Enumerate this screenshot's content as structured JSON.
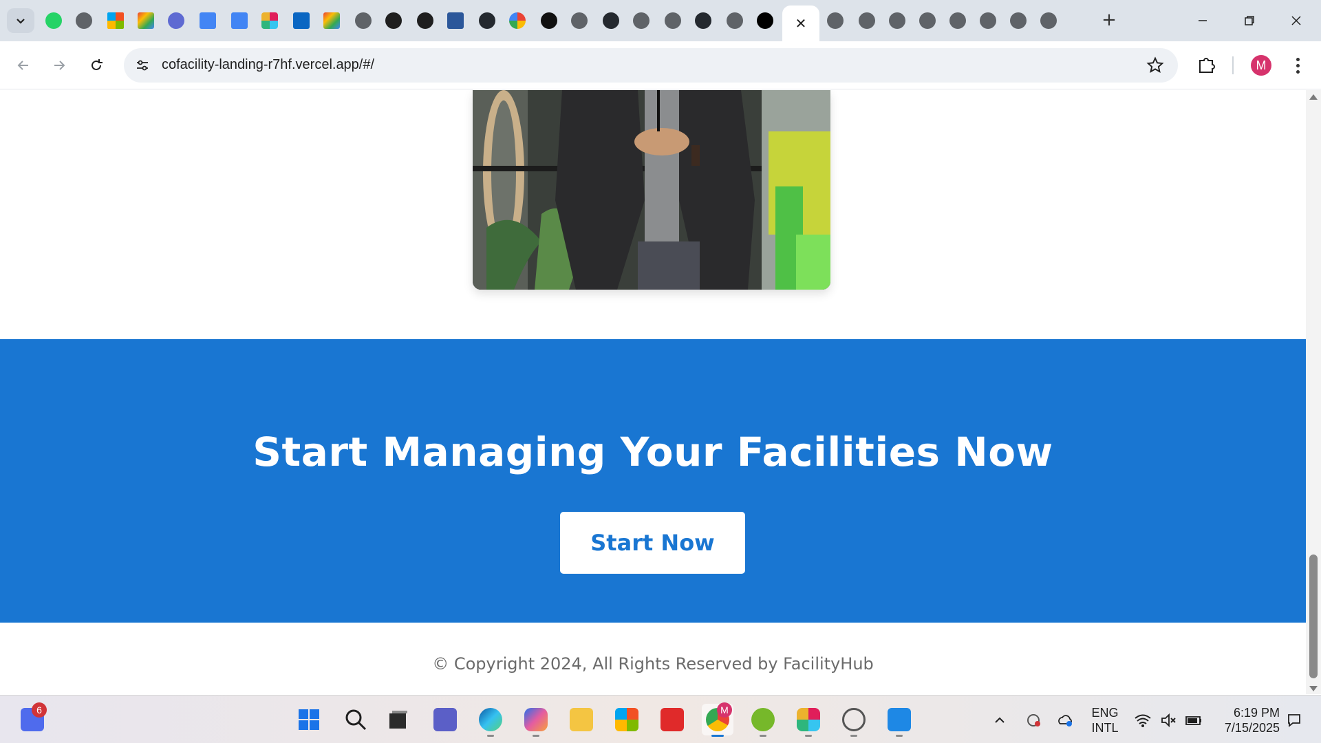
{
  "browser": {
    "address_url": "cofacility-landing-r7hf.vercel.app/#/",
    "active_tab_close": "✕",
    "new_tab_symbol": "+",
    "profile_initial": "M"
  },
  "page": {
    "cta_heading": "Start Managing Your Facilities Now",
    "cta_button": "Start Now",
    "footer_text": "© Copyright 2024, All Rights Reserved by FacilityHub"
  },
  "taskbar": {
    "chat_badge": "6",
    "chrome_badge": "M",
    "lang_primary": "ENG",
    "lang_secondary": "INTL",
    "time": "6:19 PM",
    "date": "7/15/2025"
  },
  "colors": {
    "cta_background": "#1976d2",
    "tabstrip": "#dde3ea",
    "avatar": "#d6336c"
  }
}
